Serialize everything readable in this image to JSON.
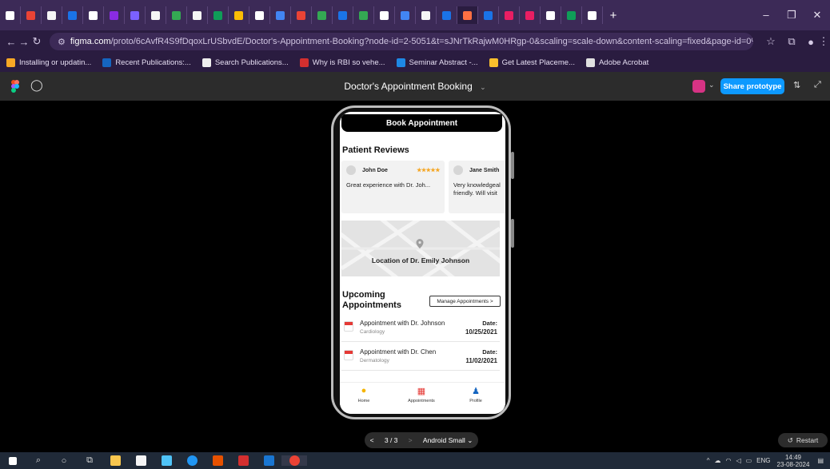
{
  "browser": {
    "tab_colors": [
      "#ffffff",
      "#ea4335",
      "#f5f5f5",
      "#1a73e8",
      "#ffffff",
      "#8a2be2",
      "#7b61ff",
      "#f5f5f5",
      "#34a853",
      "#f5f5f5",
      "#0f9d58",
      "#fbbc04",
      "#ffffff",
      "#4285f4",
      "#ea4335",
      "#34a853",
      "#1a73e8",
      "#34a853",
      "#ffffff",
      "#4285f4",
      "#f5f5f5",
      "#1a73e8",
      "#ff7043",
      "#1a73e8",
      "#e91e63",
      "#e91e63",
      "#ffffff",
      "#0f9d58",
      "#ffffff"
    ],
    "url_host": "figma.com",
    "url_path": "/proto/6cAvfR4S9fDqoxLrUSbvdE/Doctor's-Appointment-Booking?node-id=2-5051&t=sJNrTkRajwM0HRgp-0&scaling=scale-down&content-scaling=fixed&page-id=0%3A1",
    "bookmarks": [
      {
        "label": "Installing or updatin...",
        "color": "#f9a825"
      },
      {
        "label": "Recent Publications:...",
        "color": "#1565c0"
      },
      {
        "label": "Search Publications...",
        "color": "#eeeeee"
      },
      {
        "label": "Why is RBI so vehe...",
        "color": "#d32f2f"
      },
      {
        "label": "Seminar Abstract -...",
        "color": "#1e88e5"
      },
      {
        "label": "Get Latest Placeme...",
        "color": "#fbc02d"
      },
      {
        "label": "Adobe Acrobat",
        "color": "#e0e0e0"
      }
    ]
  },
  "figma": {
    "title": "Doctor's Appointment Booking",
    "share_label": "Share prototype",
    "accent": "#0d99ff"
  },
  "app": {
    "header": "Book Appointment",
    "reviews_title": "Patient Reviews",
    "reviews": [
      {
        "name": "John Doe",
        "stars": "★★★★★",
        "text": "Great experience with Dr. Joh..."
      },
      {
        "name": "Jane Smith",
        "stars": "",
        "text": "Very knowledgeal friendly. Will visit"
      }
    ],
    "map_label": "Location of Dr. Emily Johnson",
    "upcoming_title": "Upcoming Appointments",
    "manage_label": "Manage Appointments >",
    "appointments": [
      {
        "title": "Appointment with Dr. Johnson",
        "specialty": "Cardiology",
        "date_label": "Date:",
        "date": "10/25/2021"
      },
      {
        "title": "Appointment with Dr. Chen",
        "specialty": "Dermatology",
        "date_label": "Date:",
        "date": "11/02/2021"
      }
    ],
    "nav": [
      {
        "label": "Home",
        "icon": "home-icon"
      },
      {
        "label": "Appointments",
        "icon": "calendar-icon"
      },
      {
        "label": "Profile",
        "icon": "profile-icon"
      }
    ]
  },
  "proto": {
    "page_indicator": "3 / 3",
    "device": "Android Small",
    "restart_label": "Restart"
  },
  "taskbar": {
    "lang": "ENG",
    "time": "14:49",
    "date": "23-08-2024"
  }
}
